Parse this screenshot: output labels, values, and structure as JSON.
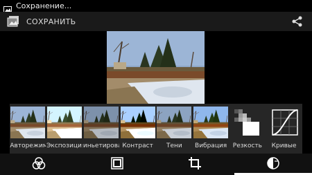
{
  "status": {
    "text": "Сохранение...",
    "icon": "image-icon"
  },
  "actionbar": {
    "save_label": "СОХРАНИТЬ",
    "app_icon": "photos-icon",
    "share_icon": "share-icon"
  },
  "filters": [
    {
      "label": "Авторежим"
    },
    {
      "label": "Экспозиция"
    },
    {
      "label": "иньетировани"
    },
    {
      "label": "Контраст"
    },
    {
      "label": "Тени"
    },
    {
      "label": "Вибрация"
    },
    {
      "label": "Резкость"
    },
    {
      "label": "Кривые"
    }
  ],
  "bottom_tabs": [
    {
      "icon": "filters-icon",
      "selected": false
    },
    {
      "icon": "borders-icon",
      "selected": false
    },
    {
      "icon": "crop-icon",
      "selected": false
    },
    {
      "icon": "adjust-icon",
      "selected": true
    }
  ]
}
